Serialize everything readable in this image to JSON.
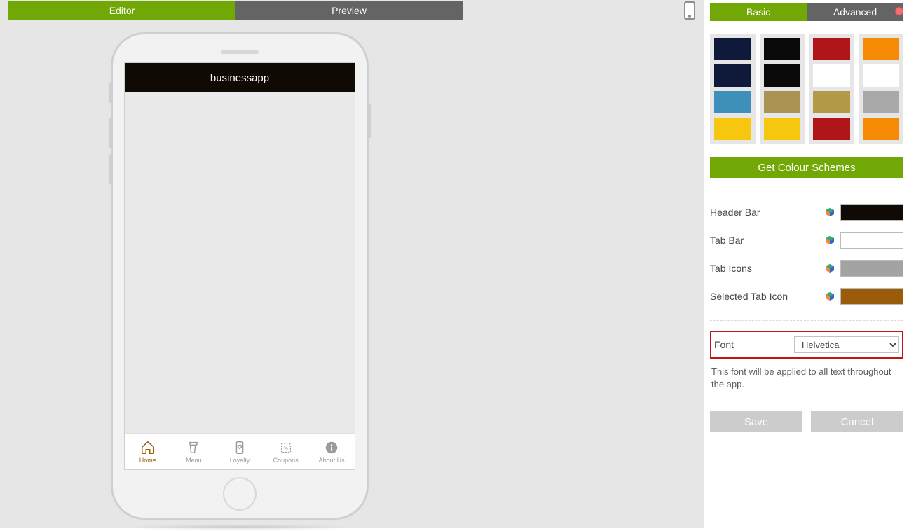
{
  "mainTabs": {
    "editor": "Editor",
    "preview": "Preview"
  },
  "panelTabs": {
    "basic": "Basic",
    "advanced": "Advanced"
  },
  "app": {
    "title": "businessapp",
    "tabs": [
      {
        "label": "Home",
        "icon": "home",
        "selected": true
      },
      {
        "label": "Menu",
        "icon": "cup"
      },
      {
        "label": "Loyalty",
        "icon": "device-heart"
      },
      {
        "label": "Coupons",
        "icon": "coupon"
      },
      {
        "label": "About Us",
        "icon": "info"
      }
    ]
  },
  "schemes": [
    [
      "#0f1a3a",
      "#0f1a3a",
      "#3f8fbb",
      "#f7c60f"
    ],
    [
      "#090909",
      "#090909",
      "#a99454",
      "#f7c60f"
    ],
    [
      "#b01619",
      "#ffffff",
      "#b39a47",
      "#b01619"
    ],
    [
      "#f58b05",
      "#ffffff",
      "#a9a9a9",
      "#f58b05"
    ]
  ],
  "getSchemesLabel": "Get Colour Schemes",
  "colorRows": [
    {
      "label": "Header Bar",
      "color": "#100a05"
    },
    {
      "label": "Tab Bar",
      "color": "#ffffff"
    },
    {
      "label": "Tab Icons",
      "color": "#a3a3a3"
    },
    {
      "label": "Selected Tab Icon",
      "color": "#9b5c0a"
    }
  ],
  "font": {
    "label": "Font",
    "value": "Helvetica",
    "help": "This font will be applied to all text throughout the app."
  },
  "actions": {
    "save": "Save",
    "cancel": "Cancel"
  }
}
